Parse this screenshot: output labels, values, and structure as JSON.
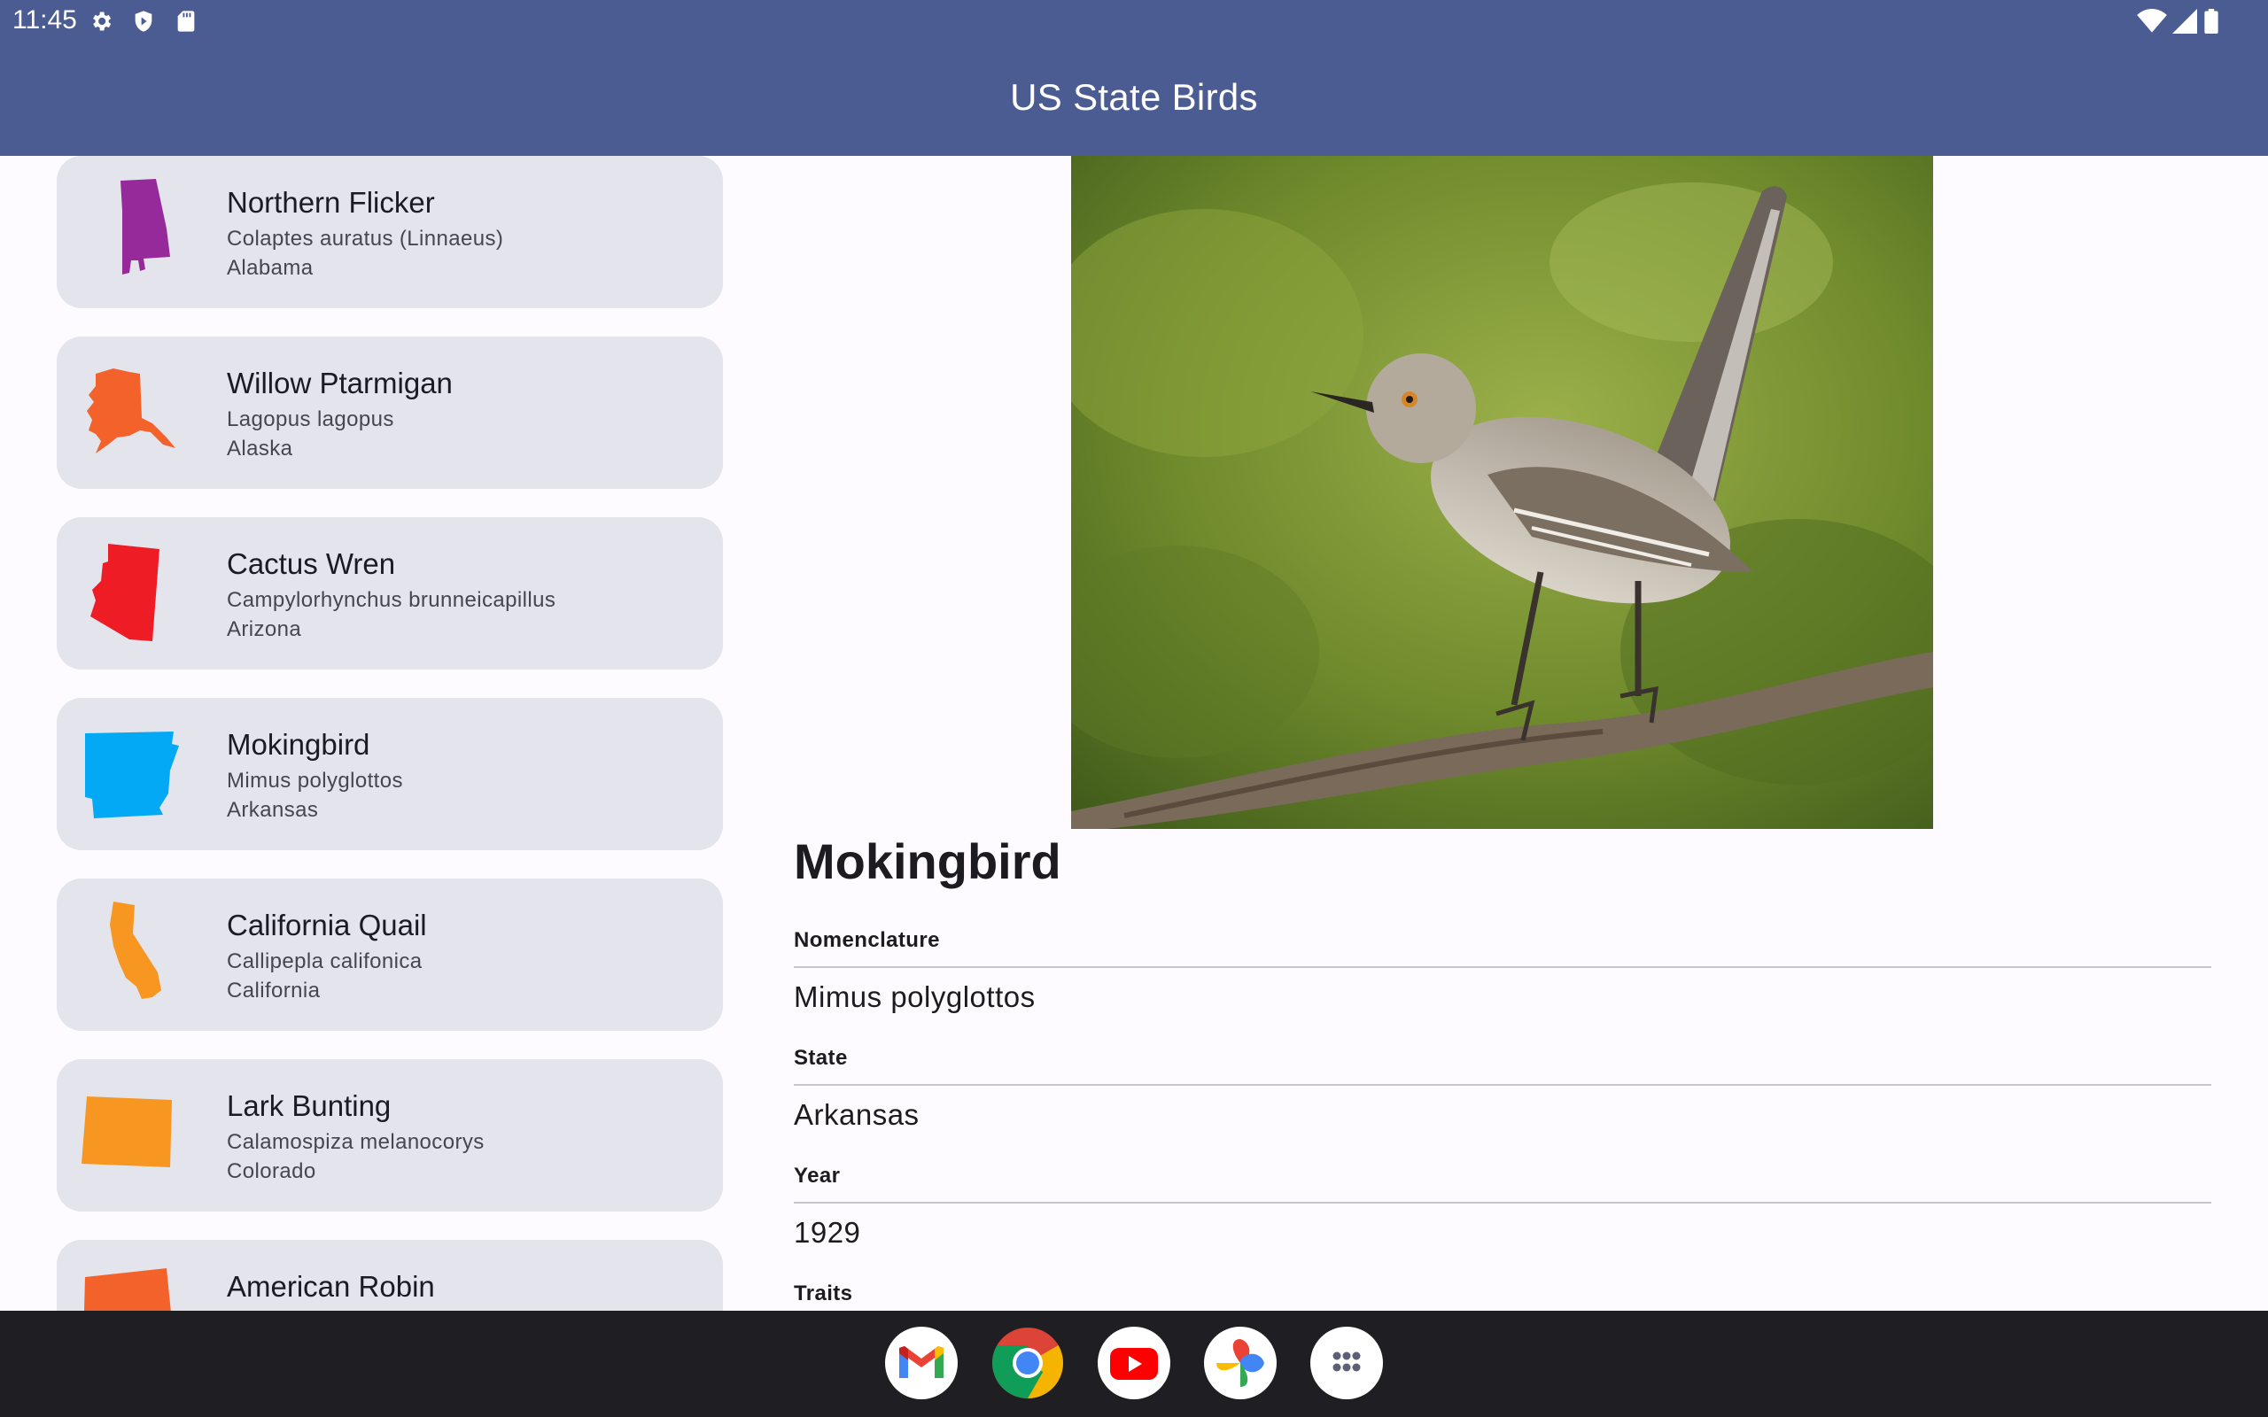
{
  "status_bar": {
    "time": "11:45",
    "left_icons": [
      "gear-icon",
      "shield-icon",
      "sd-card-icon"
    ],
    "right_icons": [
      "wifi-icon",
      "signal-icon",
      "battery-icon"
    ]
  },
  "app_bar": {
    "title": "US State Birds"
  },
  "birds": [
    {
      "name": "Northern Flicker",
      "scientific": "Colaptes auratus (Linnaeus)",
      "state": "Alabama",
      "color": "#962a9b"
    },
    {
      "name": "Willow Ptarmigan",
      "scientific": "Lagopus lagopus",
      "state": "Alaska",
      "color": "#f4622c"
    },
    {
      "name": "Cactus Wren",
      "scientific": "Campylorhynchus brunneicapillus",
      "state": "Arizona",
      "color": "#ee1c25"
    },
    {
      "name": "Mokingbird",
      "scientific": "Mimus polyglottos",
      "state": "Arkansas",
      "color": "#03a9f4"
    },
    {
      "name": "California Quail",
      "scientific": "Callipepla califonica",
      "state": "California",
      "color": "#f79621"
    },
    {
      "name": "Lark Bunting",
      "scientific": "Calamospiza melanocorys",
      "state": "Colorado",
      "color": "#f79621"
    },
    {
      "name": "American Robin",
      "scientific": "",
      "state": "",
      "color": "#f4622c"
    }
  ],
  "detail": {
    "title": "Mokingbird",
    "nomenclature_label": "Nomenclature",
    "nomenclature": "Mimus polyglottos",
    "state_label": "State",
    "state": "Arkansas",
    "year_label": "Year",
    "year": "1929",
    "traits_label": "Traits"
  },
  "dock": [
    "gmail-icon",
    "chrome-icon",
    "youtube-icon",
    "photos-icon",
    "app-drawer-icon"
  ]
}
